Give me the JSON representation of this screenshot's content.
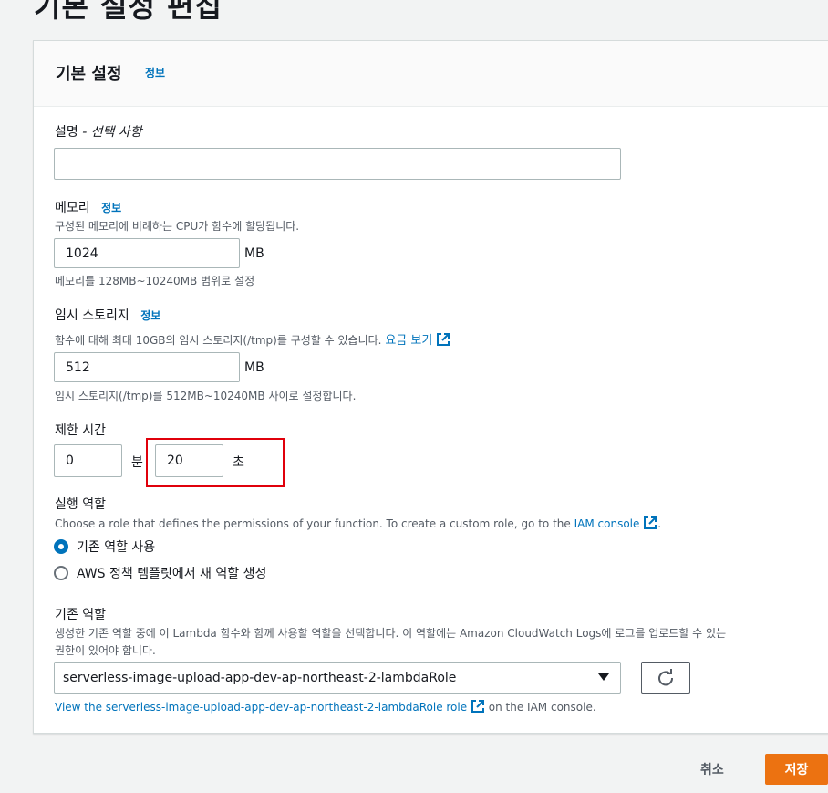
{
  "page": {
    "title": "기본 설정 편집"
  },
  "panel": {
    "title": "기본 설정",
    "info": "정보"
  },
  "description": {
    "label": "설명",
    "optional": "- 선택 사항",
    "value": ""
  },
  "memory": {
    "label": "메모리",
    "info": "정보",
    "desc": "구성된 메모리에 비례하는 CPU가 함수에 할당됩니다.",
    "value": "1024",
    "unit": "MB",
    "hint": "메모리를 128MB~10240MB 범위로 설정"
  },
  "ephemeral": {
    "label": "임시 스토리지",
    "info": "정보",
    "desc": "함수에 대해 최대 10GB의 임시 스토리지(/tmp)를 구성할 수 있습니다.",
    "link": "요금 보기",
    "value": "512",
    "unit": "MB",
    "hint": "임시 스토리지(/tmp)를 512MB~10240MB 사이로 설정합니다."
  },
  "timeout": {
    "label": "제한 시간",
    "minutes": "0",
    "min_unit": "분",
    "seconds": "20",
    "sec_unit": "초"
  },
  "role": {
    "label": "실행 역할",
    "desc": "Choose a role that defines the permissions of your function. To create a custom role, go to the",
    "desc_link": "IAM console",
    "desc_end": ".",
    "options": [
      "기존 역할 사용",
      "AWS 정책 템플릿에서 새 역할 생성"
    ],
    "selected_index": 0
  },
  "existing_role": {
    "label": "기존 역할",
    "desc_line1": "생성한 기존 역할 중에 이 Lambda 함수와 함께 사용할 역할을 선택합니다. 이 역할에는 Amazon CloudWatch Logs에 로그를 업로드할 수 있는",
    "desc_line2": "권한이 있어야 합니다.",
    "selected": "serverless-image-upload-app-dev-ap-northeast-2-lambdaRole",
    "view_link": "View the serverless-image-upload-app-dev-ap-northeast-2-lambdaRole role",
    "view_suffix": "on the IAM console."
  },
  "actions": {
    "cancel": "취소",
    "save": "저장"
  },
  "colors": {
    "accent": "#0073bb",
    "primary": "#ec7211",
    "highlight": "#e0000b"
  }
}
